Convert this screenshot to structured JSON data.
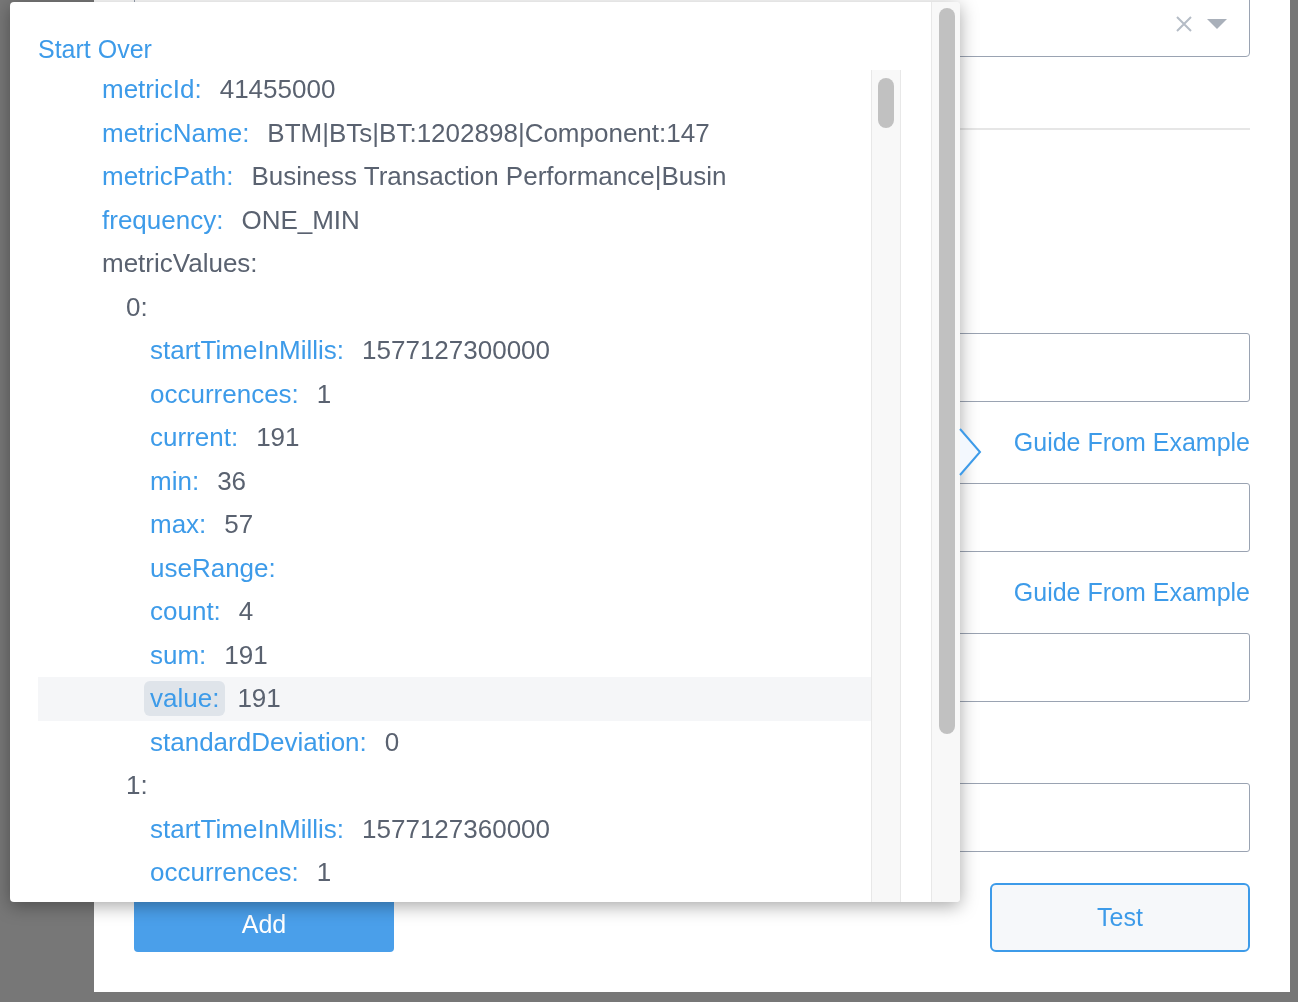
{
  "popover": {
    "start_over": "Start Over",
    "tree": [
      {
        "key": "metricId:",
        "value": "41455000",
        "selected": false
      },
      {
        "key": "metricName:",
        "value": "BTM|BTs|BT:1202898|Component:147",
        "selected": false
      },
      {
        "key": "metricPath:",
        "value": "Business Transaction Performance|Busin",
        "selected": false
      },
      {
        "key": "frequency:",
        "value": "ONE_MIN",
        "selected": false
      },
      {
        "key": "metricValues:",
        "selected": false,
        "children": [
          {
            "key": "0:",
            "selected": false,
            "children": [
              {
                "key": "startTimeInMillis:",
                "value": "1577127300000",
                "selected": false
              },
              {
                "key": "occurrences:",
                "value": "1",
                "selected": false
              },
              {
                "key": "current:",
                "value": "191",
                "selected": false
              },
              {
                "key": "min:",
                "value": "36",
                "selected": false
              },
              {
                "key": "max:",
                "value": "57",
                "selected": false
              },
              {
                "key": "useRange:",
                "selected": false
              },
              {
                "key": "count:",
                "value": "4",
                "selected": false
              },
              {
                "key": "sum:",
                "value": "191",
                "selected": false
              },
              {
                "key": "value:",
                "value": "191",
                "selected": true
              },
              {
                "key": "standardDeviation:",
                "value": "0",
                "selected": false
              }
            ]
          },
          {
            "key": "1:",
            "selected": false,
            "children": [
              {
                "key": "startTimeInMillis:",
                "value": "1577127360000",
                "selected": false
              },
              {
                "key": "occurrences:",
                "value": "1",
                "selected": false
              }
            ]
          }
        ]
      }
    ]
  },
  "form": {
    "guide_links": [
      "Guide From Example",
      "Guide From Example"
    ],
    "add_button": "Add",
    "test_button": "Test"
  }
}
